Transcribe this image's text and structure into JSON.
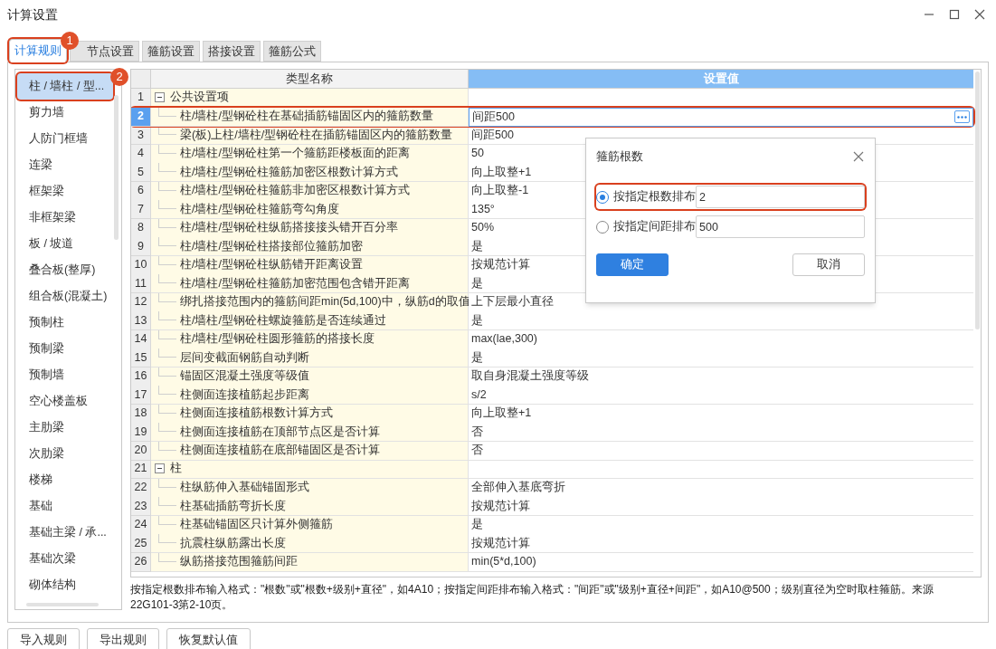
{
  "window": {
    "title": "计算设置"
  },
  "tabs": [
    {
      "label": "计算规则",
      "selected": true,
      "highlighted": true
    },
    {
      "label": "节点设置",
      "selected": false,
      "highlighted": false
    },
    {
      "label": "箍筋设置",
      "selected": false,
      "highlighted": false
    },
    {
      "label": "搭接设置",
      "selected": false,
      "highlighted": false
    },
    {
      "label": "箍筋公式",
      "selected": false,
      "highlighted": false
    }
  ],
  "annotations": [
    {
      "label": "1"
    },
    {
      "label": "2"
    }
  ],
  "sidebar": {
    "items": [
      {
        "label": "柱 / 墙柱 / 型...",
        "selected": true,
        "highlighted": true
      },
      {
        "label": "剪力墙",
        "selected": false,
        "highlighted": false
      },
      {
        "label": "人防门框墙",
        "selected": false,
        "highlighted": false
      },
      {
        "label": "连梁",
        "selected": false,
        "highlighted": false
      },
      {
        "label": "框架梁",
        "selected": false,
        "highlighted": false
      },
      {
        "label": "非框架梁",
        "selected": false,
        "highlighted": false
      },
      {
        "label": "板 / 坡道",
        "selected": false,
        "highlighted": false
      },
      {
        "label": "叠合板(整厚)",
        "selected": false,
        "highlighted": false
      },
      {
        "label": "组合板(混凝土)",
        "selected": false,
        "highlighted": false
      },
      {
        "label": "预制柱",
        "selected": false,
        "highlighted": false
      },
      {
        "label": "预制梁",
        "selected": false,
        "highlighted": false
      },
      {
        "label": "预制墙",
        "selected": false,
        "highlighted": false
      },
      {
        "label": "空心楼盖板",
        "selected": false,
        "highlighted": false
      },
      {
        "label": "主肋梁",
        "selected": false,
        "highlighted": false
      },
      {
        "label": "次肋梁",
        "selected": false,
        "highlighted": false
      },
      {
        "label": "楼梯",
        "selected": false,
        "highlighted": false
      },
      {
        "label": "基础",
        "selected": false,
        "highlighted": false
      },
      {
        "label": "基础主梁 / 承...",
        "selected": false,
        "highlighted": false
      },
      {
        "label": "基础次梁",
        "selected": false,
        "highlighted": false
      },
      {
        "label": "砌体结构",
        "selected": false,
        "highlighted": false
      }
    ]
  },
  "table": {
    "columns": [
      "类型名称",
      "设置值"
    ],
    "groups": [
      {
        "number": "1",
        "label": "公共设置项",
        "expanded": true,
        "children": [
          {
            "number": "2",
            "name": "柱/墙柱/型钢砼柱在基础插筋锚固区内的箍筋数量",
            "value": "间距500",
            "selected": true,
            "highlighted": true
          },
          {
            "number": "3",
            "name": "梁(板)上柱/墙柱/型钢砼柱在插筋锚固区内的箍筋数量",
            "value": "间距500",
            "selected": false,
            "highlighted": false
          },
          {
            "number": "4",
            "name": "柱/墙柱/型钢砼柱第一个箍筋距楼板面的距离",
            "value": "50",
            "selected": false,
            "highlighted": false
          },
          {
            "number": "5",
            "name": "柱/墙柱/型钢砼柱箍筋加密区根数计算方式",
            "value": "向上取整+1",
            "selected": false,
            "highlighted": false
          },
          {
            "number": "6",
            "name": "柱/墙柱/型钢砼柱箍筋非加密区根数计算方式",
            "value": "向上取整-1",
            "selected": false,
            "highlighted": false
          },
          {
            "number": "7",
            "name": "柱/墙柱/型钢砼柱箍筋弯勾角度",
            "value": "135°",
            "selected": false,
            "highlighted": false
          },
          {
            "number": "8",
            "name": "柱/墙柱/型钢砼柱纵筋搭接接头错开百分率",
            "value": "50%",
            "selected": false,
            "highlighted": false
          },
          {
            "number": "9",
            "name": "柱/墙柱/型钢砼柱搭接部位箍筋加密",
            "value": "是",
            "selected": false,
            "highlighted": false
          },
          {
            "number": "10",
            "name": "柱/墙柱/型钢砼柱纵筋错开距离设置",
            "value": "按规范计算",
            "selected": false,
            "highlighted": false
          },
          {
            "number": "11",
            "name": "柱/墙柱/型钢砼柱箍筋加密范围包含错开距离",
            "value": "是",
            "selected": false,
            "highlighted": false
          },
          {
            "number": "12",
            "name": "绑扎搭接范围内的箍筋间距min(5d,100)中，纵筋d的取值",
            "value": "上下层最小直径",
            "selected": false,
            "highlighted": false
          },
          {
            "number": "13",
            "name": "柱/墙柱/型钢砼柱螺旋箍筋是否连续通过",
            "value": "是",
            "selected": false,
            "highlighted": false
          },
          {
            "number": "14",
            "name": "柱/墙柱/型钢砼柱圆形箍筋的搭接长度",
            "value": "max(lae,300)",
            "selected": false,
            "highlighted": false
          },
          {
            "number": "15",
            "name": "层间变截面钢筋自动判断",
            "value": "是",
            "selected": false,
            "highlighted": false
          },
          {
            "number": "16",
            "name": "锚固区混凝土强度等级值",
            "value": "取自身混凝土强度等级",
            "selected": false,
            "highlighted": false
          },
          {
            "number": "17",
            "name": "柱侧面连接植筋起步距离",
            "value": "s/2",
            "selected": false,
            "highlighted": false
          },
          {
            "number": "18",
            "name": "柱侧面连接植筋根数计算方式",
            "value": "向上取整+1",
            "selected": false,
            "highlighted": false
          },
          {
            "number": "19",
            "name": "柱侧面连接植筋在顶部节点区是否计算",
            "value": "否",
            "selected": false,
            "highlighted": false
          },
          {
            "number": "20",
            "name": "柱侧面连接植筋在底部锚固区是否计算",
            "value": "否",
            "selected": false,
            "highlighted": false
          }
        ]
      },
      {
        "number": "21",
        "label": "柱",
        "expanded": true,
        "children": [
          {
            "number": "22",
            "name": "柱纵筋伸入基础锚固形式",
            "value": "全部伸入基底弯折",
            "selected": false,
            "highlighted": false
          },
          {
            "number": "23",
            "name": "柱基础插筋弯折长度",
            "value": "按规范计算",
            "selected": false,
            "highlighted": false
          },
          {
            "number": "24",
            "name": "柱基础锚固区只计算外侧箍筋",
            "value": "是",
            "selected": false,
            "highlighted": false
          },
          {
            "number": "25",
            "name": "抗震柱纵筋露出长度",
            "value": "按规范计算",
            "selected": false,
            "highlighted": false
          },
          {
            "number": "26",
            "name": "纵筋搭接范围箍筋间距",
            "value": "min(5*d,100)",
            "selected": false,
            "highlighted": false
          }
        ]
      }
    ]
  },
  "help_text": "按指定根数排布输入格式：\"根数\"或\"根数+级别+直径\"，如4A10；按指定间距排布输入格式：\"间距\"或\"级别+直径+间距\"，如A10@500；级别直径为空时取柱箍筋。来源22G101-3第2-10页。",
  "buttons": [
    "导入规则",
    "导出规则",
    "恢复默认值"
  ],
  "dialog": {
    "title": "箍筋根数",
    "options": [
      {
        "label": "按指定根数排布",
        "value": "2",
        "selected": true,
        "highlighted": true
      },
      {
        "label": "按指定间距排布",
        "value": "500",
        "selected": false,
        "highlighted": false
      }
    ],
    "buttons": [
      {
        "label": "确定",
        "kind": "primary"
      },
      {
        "label": "取消",
        "kind": "secondary"
      }
    ]
  }
}
